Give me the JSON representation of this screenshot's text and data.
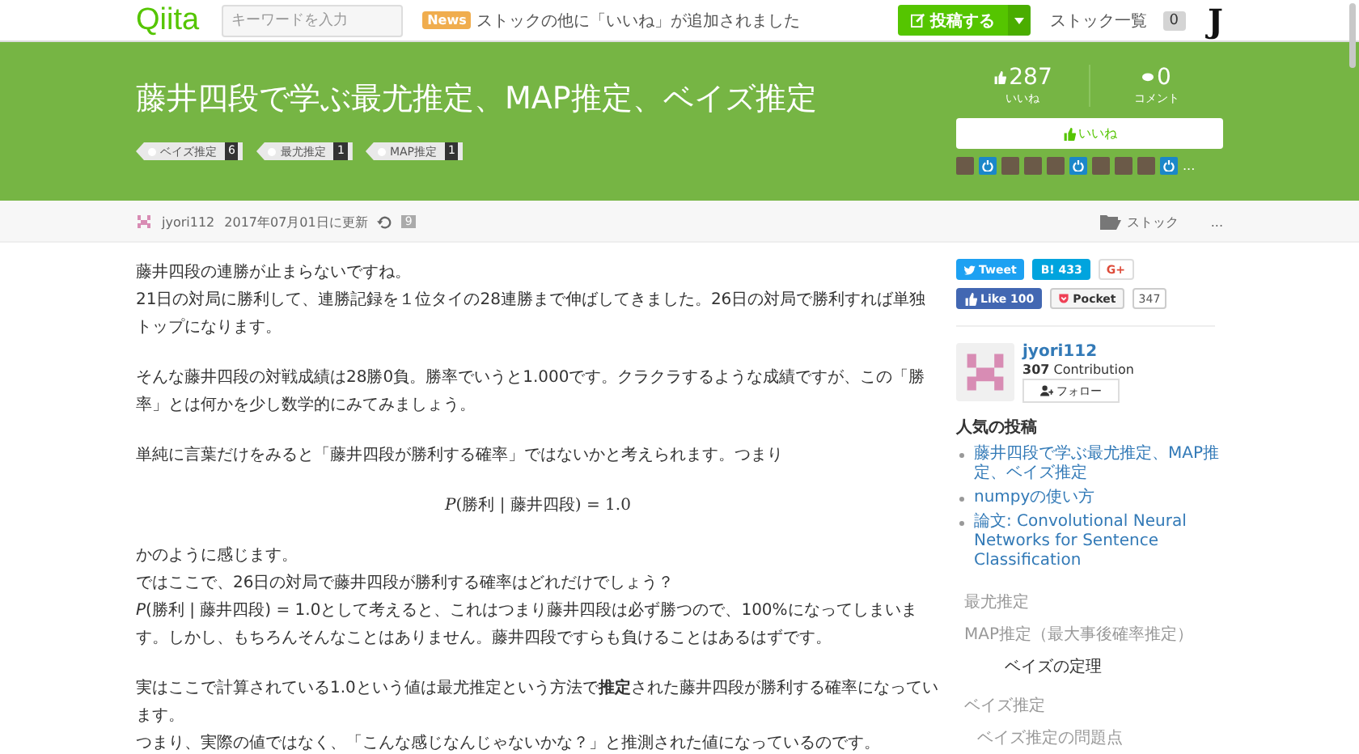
{
  "header": {
    "logo": "Qiita",
    "search": {
      "placeholder": "キーワードを入力"
    },
    "news": {
      "badge": "News",
      "text": "ストックの他に「いいね」が追加されました"
    },
    "post_button": "投稿する",
    "stock_list": "ストック一覧",
    "notification_count": "0",
    "avatar_letter": "J"
  },
  "article": {
    "title": "藤井四段で学ぶ最尤推定、MAP推定、ベイズ推定",
    "tags": [
      {
        "label": "ベイズ推定",
        "count": "6"
      },
      {
        "label": "最尤推定",
        "count": "1"
      },
      {
        "label": "MAP推定",
        "count": "1"
      }
    ],
    "likes": {
      "count": "287",
      "label": "いいね"
    },
    "comments": {
      "count": "0",
      "label": "コメント"
    },
    "like_button": "いいね",
    "likers": [
      {
        "kind": "photo"
      },
      {
        "kind": "default"
      },
      {
        "kind": "photo"
      },
      {
        "kind": "photo"
      },
      {
        "kind": "photo"
      },
      {
        "kind": "default"
      },
      {
        "kind": "photo"
      },
      {
        "kind": "photo"
      },
      {
        "kind": "photo"
      },
      {
        "kind": "default"
      }
    ],
    "author": "jyori112",
    "updated": "2017年07月01日に更新",
    "revisions": "9",
    "stock": "ストック",
    "more": "..."
  },
  "body": [
    {
      "kind": "text",
      "lines": [
        "藤井四段の連勝が止まらないですね。",
        "21日の対局に勝利して、連勝記録を１位タイの28連勝まで伸ばしてきました。26日の対局で勝利すれば単独トップになります。"
      ]
    },
    {
      "kind": "text",
      "lines": [
        "そんな藤井四段の対戦成績は28勝0負。勝率でいうと1.000です。クラクラするような成績ですが、この「勝率」とは何かを少し数学的にみてみましょう。"
      ]
    },
    {
      "kind": "text",
      "lines": [
        "単純に言葉だけをみると「藤井四段が勝利する確率」ではないかと考えられます。つまり"
      ]
    },
    {
      "kind": "math",
      "lines": [
        "*P*(勝利 | 藤井四段) = 1.0"
      ]
    },
    {
      "kind": "text",
      "lines": [
        "かのように感じます。",
        "ではここで、26日の対局で藤井四段が勝利する確率はどれだけでしょう？",
        "*P*(勝利 | 藤井四段) = 1.0として考えると、これはつまり藤井四段は必ず勝つので、100%になってしまいます。しかし、もちろんそんなことはありません。藤井四段ですらも負けることはあるはずです。"
      ]
    },
    {
      "kind": "text",
      "lines": [
        "実はここで計算されている1.0という値は最尤推定という方法で**推定**された藤井四段が勝利する確率になっています。",
        "つまり、実際の値ではなく、「こんな感じなんじゃないかな？」と推測された値になっているのです。"
      ]
    }
  ],
  "sidebar": {
    "share": [
      {
        "kind": "twitter",
        "label": "Tweet"
      },
      {
        "kind": "hatena",
        "label": "B! 433"
      },
      {
        "kind": "google",
        "label": "G+"
      }
    ],
    "share2": [
      {
        "kind": "facebook",
        "label": "Like 100"
      },
      {
        "kind": "pocket",
        "label": "Pocket",
        "count": "347"
      }
    ],
    "profile": {
      "name": "jyori112",
      "contribution": "307",
      "contribution_label": "Contribution",
      "follow": "フォロー"
    },
    "popular_title": "人気の投稿",
    "popular": [
      "藤井四段で学ぶ最尤推定、MAP推定、ベイズ推定",
      "numpyの使い方",
      "論文: Convolutional Neural Networks for Sentence Classification"
    ],
    "toc": [
      {
        "label": "最尤推定",
        "selected": false
      },
      {
        "label": "MAP推定（最大事後確率推定）",
        "selected": false,
        "children": [
          {
            "label": "ベイズの定理",
            "selected": true
          }
        ]
      },
      {
        "label": "ベイズ推定",
        "selected": false,
        "children": [
          {
            "label": "ベイズ推定の問題点",
            "selected": false
          }
        ]
      }
    ]
  }
}
